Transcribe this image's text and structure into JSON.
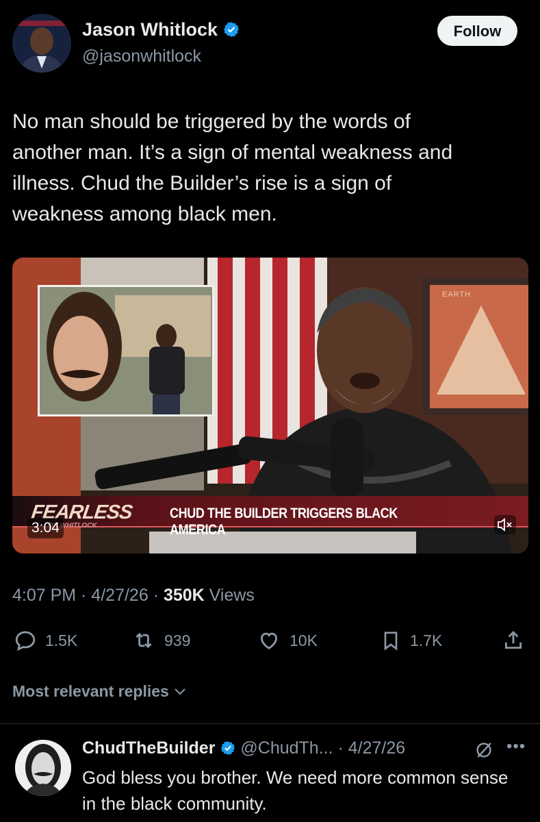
{
  "author": {
    "name": "Jason Whitlock",
    "handle": "@jasonwhitlock",
    "follow_label": "Follow"
  },
  "tweet": {
    "text": "No man should be triggered by the words of\nanother man. It’s a sign of mental weakness and\nillness. Chud the Builder’s rise is a sign of\nweakness among black men."
  },
  "video": {
    "brand": "FEARLESS",
    "brand_sub": "ON WHITLOCK",
    "headline": "CHUD THE BUILDER TRIGGERS BLACK AMERICA",
    "duration": "3:04",
    "poster_text": "EARTH"
  },
  "meta": {
    "time": "4:07 PM",
    "sep1": " · ",
    "date": "4/27/26",
    "sep2": " · ",
    "views_count": "350K",
    "views_label": " Views"
  },
  "actions": {
    "replies": "1.5K",
    "reposts": "939",
    "likes": "10K",
    "bookmarks": "1.7K"
  },
  "replies_filter": "Most relevant replies",
  "reply": {
    "name": "ChudTheBuilder",
    "handle_date": "@ChudTh... · 4/27/26",
    "text": "God bless you brother. We need more common sense in the black community."
  },
  "colors": {
    "background": "#000000",
    "text": "#e7e9ea",
    "muted": "#8b98a5",
    "verified": "#1d9bf0",
    "headline_bar": "#7a1c22"
  },
  "icons": [
    "verified-badge-icon",
    "reply-icon",
    "repost-icon",
    "like-icon",
    "bookmark-icon",
    "share-icon",
    "chevron-down-icon",
    "mute-icon",
    "grok-icon",
    "more-icon"
  ]
}
